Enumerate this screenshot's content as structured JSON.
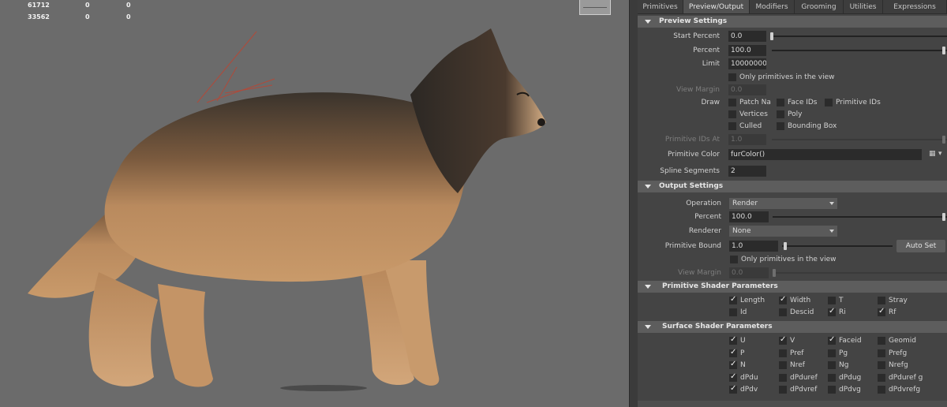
{
  "viewport": {
    "stats": [
      {
        "a": "61712",
        "b": "0",
        "c": "0"
      },
      {
        "a": "33562",
        "b": "0",
        "c": "0"
      }
    ]
  },
  "tabs": [
    {
      "label": "Primitives"
    },
    {
      "label": "Preview/Output"
    },
    {
      "label": "Modifiers"
    },
    {
      "label": "Grooming"
    },
    {
      "label": "Utilities"
    },
    {
      "label": "Expressions"
    }
  ],
  "preview": {
    "title": "Preview Settings",
    "start_percent_label": "Start Percent",
    "start_percent": "0.0",
    "percent_label": "Percent",
    "percent": "100.0",
    "limit_label": "Limit",
    "limit": "100000000",
    "only_prims_label": "Only primitives in the view",
    "view_margin_label": "View Margin",
    "view_margin": "0.0",
    "draw_label": "Draw",
    "draw_options": {
      "patch": "Patch Na",
      "face_ids": "Face IDs",
      "prim_ids": "Primitive IDs",
      "vertices": "Vertices",
      "poly": "Poly",
      "culled": "Culled",
      "bbox": "Bounding Box"
    },
    "prim_ids_at_label": "Primitive IDs At",
    "prim_ids_at": "1.0",
    "prim_color_label": "Primitive Color",
    "prim_color": "furColor()",
    "spline_label": "Spline Segments",
    "spline": "2"
  },
  "output": {
    "title": "Output Settings",
    "operation_label": "Operation",
    "operation": "Render",
    "percent_label": "Percent",
    "percent": "100.0",
    "renderer_label": "Renderer",
    "renderer": "None",
    "prim_bound_label": "Primitive Bound",
    "prim_bound": "1.0",
    "auto_set": "Auto Set",
    "only_prims_label": "Only primitives in the view",
    "view_margin_label": "View Margin",
    "view_margin": "0.0"
  },
  "prim_shader": {
    "title": "Primitive Shader Parameters",
    "items": [
      "Length",
      "Width",
      "T",
      "Stray",
      "Id",
      "Descid",
      "Ri",
      "Rf"
    ]
  },
  "surf_shader": {
    "title": "Surface Shader Parameters",
    "items": [
      "U",
      "V",
      "Faceid",
      "Geomid",
      "P",
      "Pref",
      "Pg",
      "Prefg",
      "N",
      "Nref",
      "Ng",
      "Nrefg",
      "dPdu",
      "dPduref",
      "dPdug",
      "dPduref g",
      "dPdv",
      "dPdvref",
      "dPdvg",
      "dPdvrefg"
    ]
  }
}
